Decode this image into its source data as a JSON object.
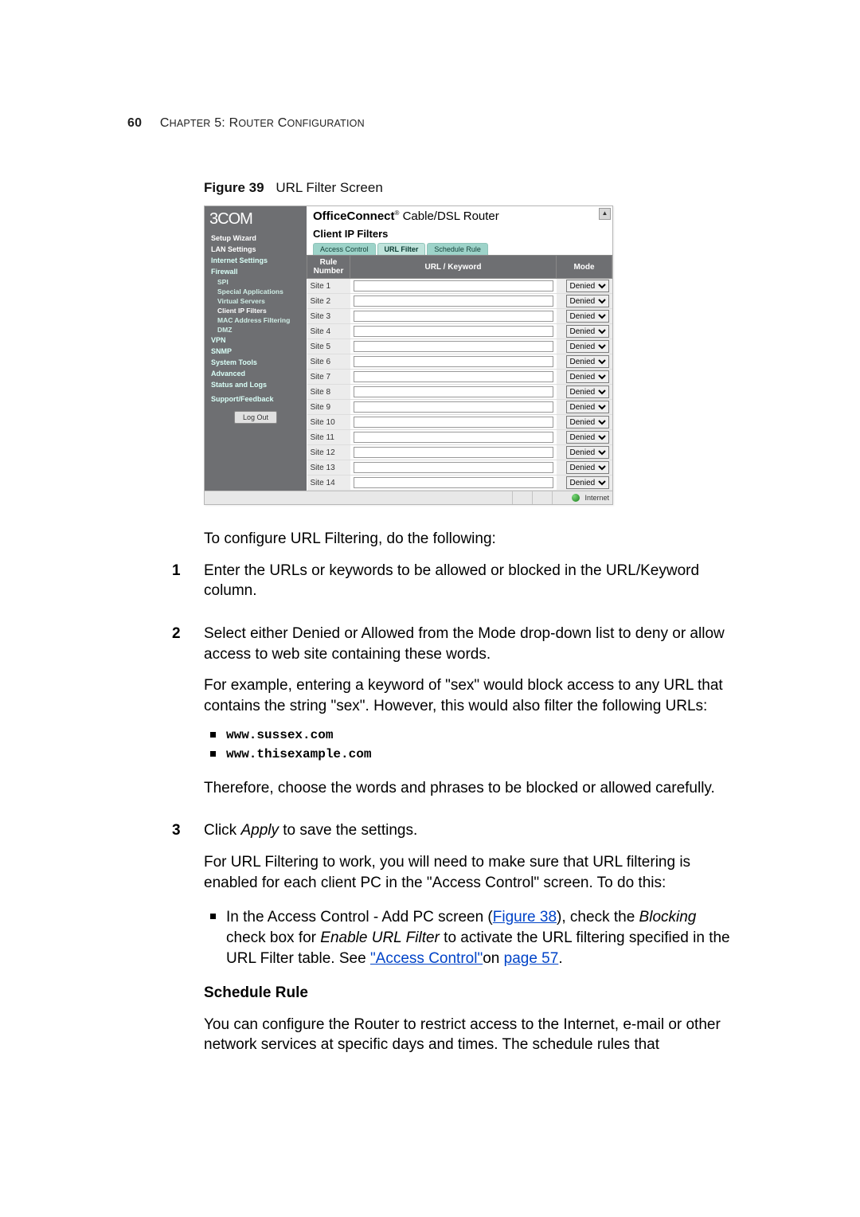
{
  "header": {
    "page_number": "60",
    "chapter_text": "Chapter 5: Router Configuration"
  },
  "figure": {
    "label": "Figure 39",
    "caption": "URL Filter Screen"
  },
  "screenshot": {
    "brand": "3COM",
    "title_bold": "OfficeConnect",
    "title_rest": " Cable/DSL Router",
    "subtitle": "Client IP Filters",
    "sidebar_items": [
      {
        "label": "Setup Wizard",
        "type": "top"
      },
      {
        "label": "LAN Settings",
        "type": "top"
      },
      {
        "label": "Internet Settings",
        "type": "top",
        "teal": true
      },
      {
        "label": "Firewall",
        "type": "top",
        "teal": true
      },
      {
        "label": "SPI",
        "type": "sub"
      },
      {
        "label": "Special Applications",
        "type": "sub"
      },
      {
        "label": "Virtual Servers",
        "type": "sub"
      },
      {
        "label": "Client IP Filters",
        "type": "sub",
        "active": true
      },
      {
        "label": "MAC Address Filtering",
        "type": "sub"
      },
      {
        "label": "DMZ",
        "type": "sub"
      },
      {
        "label": "VPN",
        "type": "top",
        "teal": true
      },
      {
        "label": "SNMP",
        "type": "top",
        "teal": true
      },
      {
        "label": "System Tools",
        "type": "top",
        "teal": true
      },
      {
        "label": "Advanced",
        "type": "top",
        "teal": true
      },
      {
        "label": "Status and Logs",
        "type": "top",
        "teal": true
      },
      {
        "label": "Support/Feedback",
        "type": "top",
        "teal": true
      }
    ],
    "logout": "Log Out",
    "tabs": [
      {
        "label": "Access Control",
        "active": false
      },
      {
        "label": "URL Filter",
        "active": true
      },
      {
        "label": "Schedule Rule",
        "active": false
      }
    ],
    "table": {
      "headers": [
        "Rule Number",
        "URL / Keyword",
        "Mode"
      ],
      "rows": [
        {
          "label": "Site 1",
          "url": "",
          "mode": "Denied"
        },
        {
          "label": "Site 2",
          "url": "",
          "mode": "Denied"
        },
        {
          "label": "Site 3",
          "url": "",
          "mode": "Denied"
        },
        {
          "label": "Site 4",
          "url": "",
          "mode": "Denied"
        },
        {
          "label": "Site 5",
          "url": "",
          "mode": "Denied"
        },
        {
          "label": "Site 6",
          "url": "",
          "mode": "Denied"
        },
        {
          "label": "Site 7",
          "url": "",
          "mode": "Denied"
        },
        {
          "label": "Site 8",
          "url": "",
          "mode": "Denied"
        },
        {
          "label": "Site 9",
          "url": "",
          "mode": "Denied"
        },
        {
          "label": "Site 10",
          "url": "",
          "mode": "Denied"
        },
        {
          "label": "Site 11",
          "url": "",
          "mode": "Denied"
        },
        {
          "label": "Site 12",
          "url": "",
          "mode": "Denied"
        },
        {
          "label": "Site 13",
          "url": "",
          "mode": "Denied"
        },
        {
          "label": "Site 14",
          "url": "",
          "mode": "Denied"
        }
      ]
    },
    "status": "Internet"
  },
  "body": {
    "intro": "To configure URL Filtering, do the following:",
    "step1": "Enter the URLs or keywords to be allowed or blocked in the URL/Keyword column.",
    "step2": "Select either Denied or Allowed from the Mode drop-down list to deny or allow access to web site containing these words.",
    "step2_p2": "For example, entering a keyword of \"sex\" would block access to any URL that contains the string \"sex\". However, this would also filter the following URLs:",
    "examples": [
      "www.sussex.com",
      "www.thisexample.com"
    ],
    "step2_p3": "Therefore, choose the words and phrases to be blocked or allowed carefully.",
    "step3_pre": "Click ",
    "step3_apply": "Apply",
    "step3_post": " to save the settings.",
    "step3_p2": "For URL Filtering to work, you will need to make sure that URL filtering is enabled for each client PC in the \"Access Control\" screen. To do this:",
    "bullet_a": "In the Access Control - Add PC screen (",
    "bullet_fig_link": "Figure 38",
    "bullet_b": "), check the ",
    "bullet_blocking": "Blocking",
    "bullet_c": " check box for ",
    "bullet_enable": "Enable URL Filter",
    "bullet_d": " to activate the URL filtering specified in the URL Filter table. See ",
    "bullet_ac_link": "\"Access Control\"",
    "bullet_e": "on ",
    "bullet_page_link": "page 57",
    "bullet_f": ".",
    "schedule_hd": "Schedule Rule",
    "schedule_p": "You can configure the Router to restrict access to the Internet, e-mail or other network services at specific days and times. The schedule rules that"
  }
}
